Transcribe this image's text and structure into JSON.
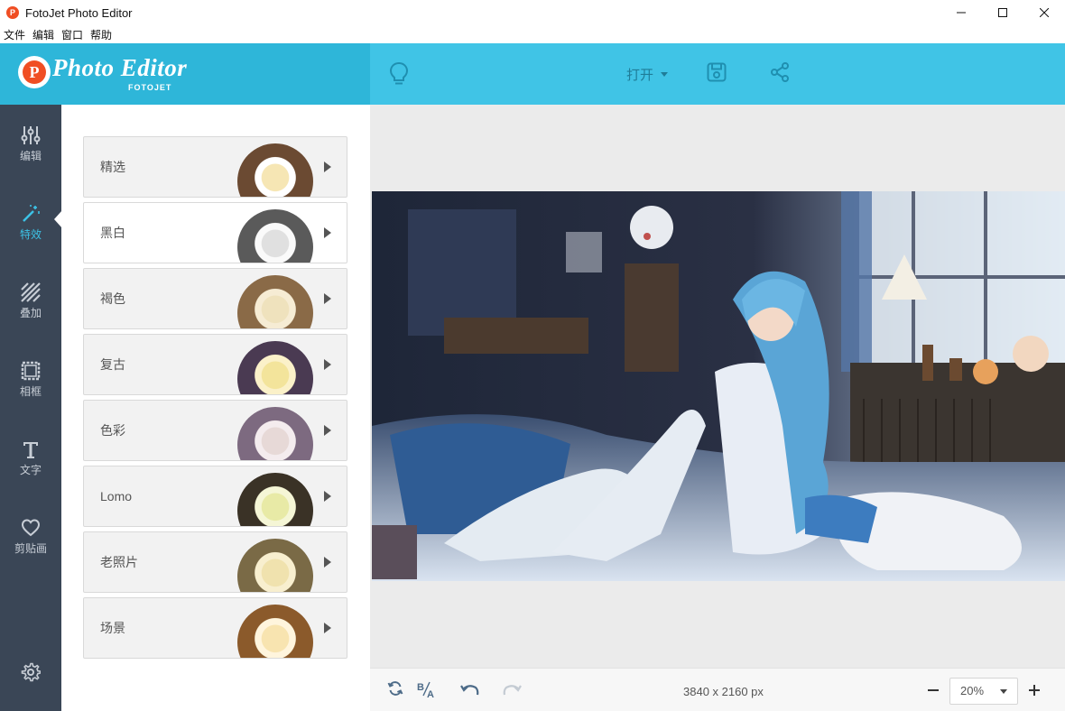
{
  "window": {
    "title": "FotoJet Photo Editor",
    "app_icon_letter": "P"
  },
  "menu": [
    "文件",
    "编辑",
    "窗口",
    "帮助"
  ],
  "header": {
    "logo_letter": "P",
    "logo_text": "Photo Editor",
    "logo_sub": "FOTOJET",
    "open_label": "打开",
    "accent": "#40c4e6"
  },
  "nav": {
    "items": [
      {
        "label": "编辑",
        "icon": "sliders-icon"
      },
      {
        "label": "特效",
        "icon": "magic-wand-icon"
      },
      {
        "label": "叠加",
        "icon": "overlay-stripes-icon"
      },
      {
        "label": "相框",
        "icon": "frame-icon"
      },
      {
        "label": "文字",
        "icon": "text-icon"
      },
      {
        "label": "剪贴画",
        "icon": "heart-icon"
      }
    ],
    "active": "特效",
    "settings_icon": "gear-icon"
  },
  "filters": [
    {
      "label": "精选",
      "tone": "natural"
    },
    {
      "label": "黑白",
      "tone": "grayscale"
    },
    {
      "label": "褐色",
      "tone": "sepia"
    },
    {
      "label": "复古",
      "tone": "vintage"
    },
    {
      "label": "色彩",
      "tone": "color"
    },
    {
      "label": "Lomo",
      "tone": "lomo"
    },
    {
      "label": "老照片",
      "tone": "old-photo"
    },
    {
      "label": "场景",
      "tone": "scene"
    }
  ],
  "selected_filter": "黑白",
  "status": {
    "dimensions": "3840 x 2160 px",
    "zoom": "20%"
  }
}
